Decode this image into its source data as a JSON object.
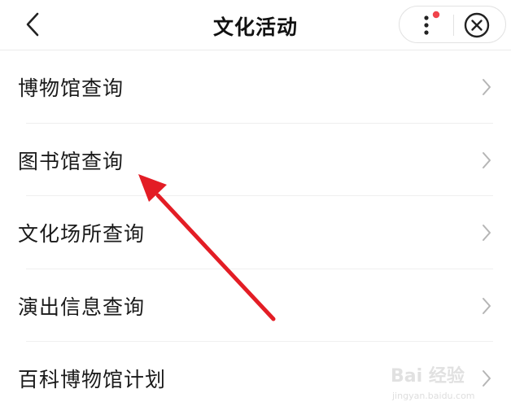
{
  "header": {
    "title": "文化活动",
    "back_icon": "chevron-left-icon",
    "more_icon": "more-vertical-icon",
    "close_icon": "close-circle-icon",
    "notification_dot_color": "#f0434b"
  },
  "menu": {
    "items": [
      {
        "label": "博物馆查询"
      },
      {
        "label": "图书馆查询"
      },
      {
        "label": "文化场所查询"
      },
      {
        "label": "演出信息查询"
      },
      {
        "label": "百科博物馆计划"
      }
    ],
    "chevron_icon": "chevron-right-icon"
  },
  "annotation": {
    "arrow_icon": "red-arrow-icon",
    "color": "#e31d25"
  },
  "watermark": {
    "logo": "Bai 经验",
    "url": "jingyan.baidu.com"
  }
}
